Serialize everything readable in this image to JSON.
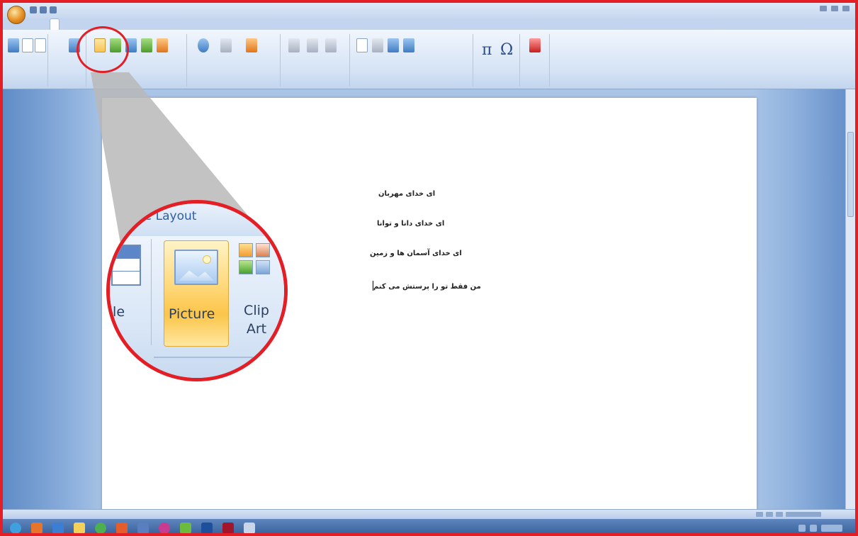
{
  "ribbon": {
    "callout_label": "Picture"
  },
  "document": {
    "lines": [
      "ای خدای مهربان",
      "ای خدای دانا و توانا",
      "ای خدای آسمان ها و زمین",
      "من فقط تو را پرستش می کنم"
    ]
  },
  "zoom_callout": {
    "tab_text": "ge Layout",
    "table_label": "ble",
    "picture_label": "Picture",
    "clipart_label": "Clip\nArt"
  },
  "colors": {
    "callout_red": "#e31e25",
    "picture_highlight": "#fbc548",
    "ribbon_blue": "#d5e3f5"
  }
}
